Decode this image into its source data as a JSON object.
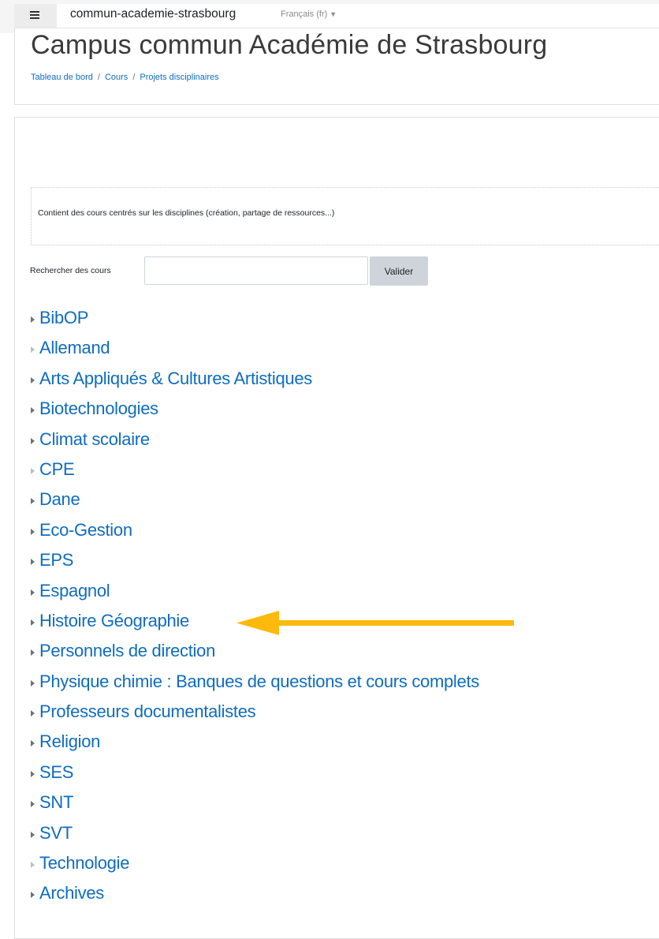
{
  "navbar": {
    "site_name": "commun-academie-strasbourg",
    "language": "Français (fr)",
    "menu_icon": "hamburger-icon",
    "lang_caret_icon": "caret-down-icon"
  },
  "header": {
    "title": "Campus commun Académie de Strasbourg",
    "breadcrumb": [
      "Tableau de bord",
      "Cours",
      "Projets disciplinaires"
    ]
  },
  "category": {
    "description": "Contient des cours centrés sur les disciplines (création, partage de ressources...)"
  },
  "search": {
    "label": "Rechercher des cours",
    "value": "",
    "placeholder": "",
    "button_label": "Valider"
  },
  "subcategories": [
    {
      "label": "BibOP",
      "expandable": true
    },
    {
      "label": "Allemand",
      "expandable": false
    },
    {
      "label": "Arts Appliqués & Cultures Artistiques",
      "expandable": true
    },
    {
      "label": "Biotechnologies",
      "expandable": true
    },
    {
      "label": "Climat scolaire",
      "expandable": true
    },
    {
      "label": "CPE",
      "expandable": false
    },
    {
      "label": "Dane",
      "expandable": true
    },
    {
      "label": "Eco-Gestion",
      "expandable": true
    },
    {
      "label": "EPS",
      "expandable": true
    },
    {
      "label": "Espagnol",
      "expandable": true
    },
    {
      "label": "Histoire Géographie",
      "expandable": true
    },
    {
      "label": "Personnels de direction",
      "expandable": true
    },
    {
      "label": "Physique chimie : Banques de questions et cours complets",
      "expandable": true
    },
    {
      "label": "Professeurs documentalistes",
      "expandable": true
    },
    {
      "label": "Religion",
      "expandable": true
    },
    {
      "label": "SES",
      "expandable": true
    },
    {
      "label": "SNT",
      "expandable": true
    },
    {
      "label": "SVT",
      "expandable": true
    },
    {
      "label": "Technologie",
      "expandable": false
    },
    {
      "label": "Archives",
      "expandable": true
    }
  ],
  "annotation": {
    "type": "arrow",
    "color": "#FDBA0D",
    "points_to": "Histoire Géographie"
  },
  "colors": {
    "link": "#0f6cbf",
    "button_bg": "#ced4da",
    "text": "#1d2125"
  }
}
